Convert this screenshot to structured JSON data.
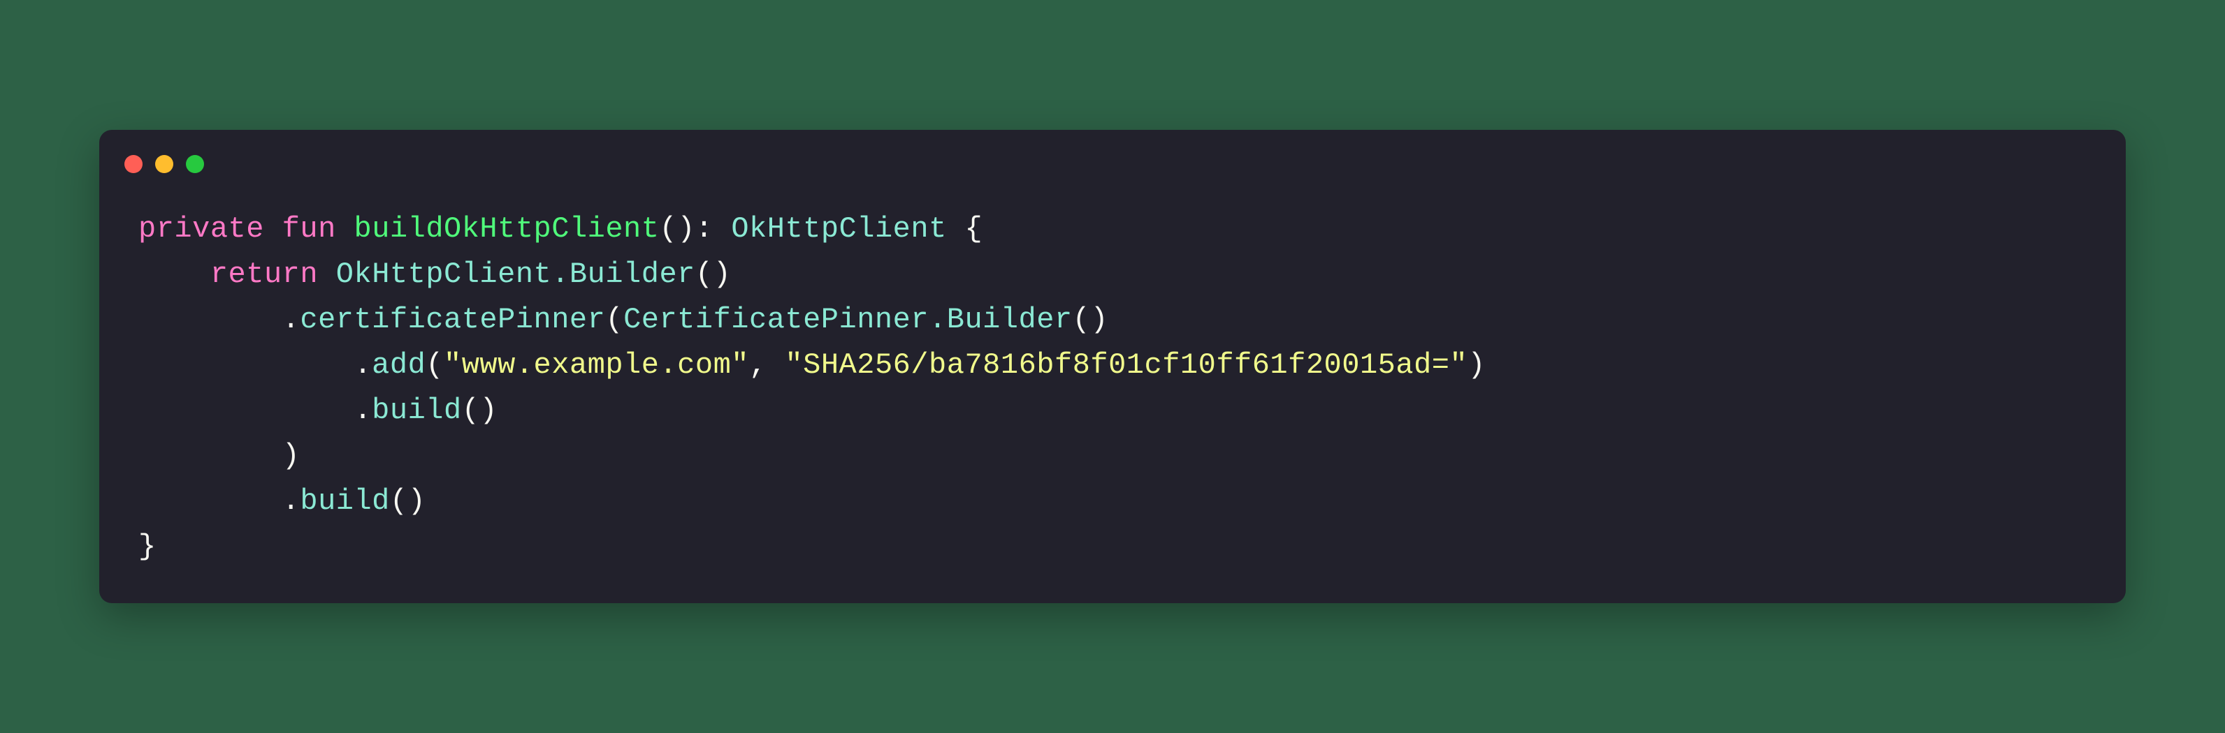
{
  "code": {
    "line1": {
      "kw_private": "private",
      "kw_fun": "fun",
      "fn_name": "buildOkHttpClient",
      "return_type": "OkHttpClient"
    },
    "line2": {
      "kw_return": "return",
      "builder": "OkHttpClient.Builder"
    },
    "line3": {
      "method": "certificatePinner",
      "inner": "CertificatePinner.Builder"
    },
    "line4": {
      "method": "add",
      "arg1": "\"www.example.com\"",
      "arg2": "\"SHA256/ba7816bf8f01cf10ff61f20015ad=\""
    },
    "line5": {
      "method": "build"
    },
    "line7": {
      "method": "build"
    }
  }
}
